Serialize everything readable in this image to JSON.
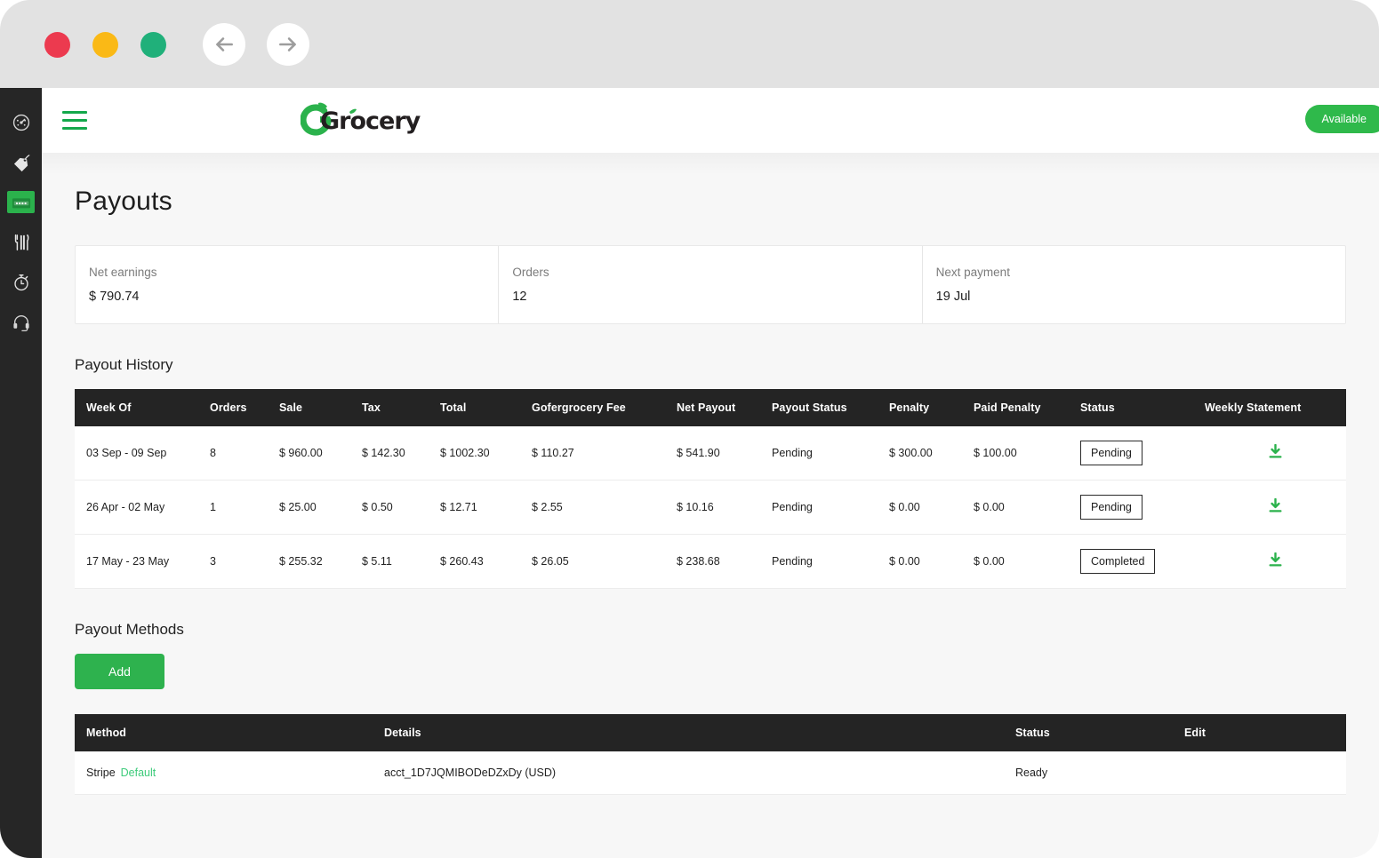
{
  "window": {
    "traffic_lights": [
      {
        "name": "close",
        "color": "#ec3a4f"
      },
      {
        "name": "minimize",
        "color": "#fab916"
      },
      {
        "name": "zoom",
        "color": "#20b07a"
      }
    ],
    "nav": {
      "back_label": "Back",
      "forward_label": "Forward"
    }
  },
  "sidebar": {
    "items": [
      {
        "name": "dashboard",
        "icon": "speedometer-icon",
        "active": false
      },
      {
        "name": "offers",
        "icon": "tag-icon",
        "active": false
      },
      {
        "name": "payouts",
        "icon": "money-card-icon",
        "active": true
      },
      {
        "name": "menu",
        "icon": "cutlery-icon",
        "active": false
      },
      {
        "name": "hours",
        "icon": "stopwatch-icon",
        "active": false
      },
      {
        "name": "support",
        "icon": "headset-icon",
        "active": false
      }
    ]
  },
  "appbar": {
    "menu_label": "Menu",
    "logo_text": "Grocery",
    "status_badge": "Available"
  },
  "page": {
    "title": "Payouts"
  },
  "summary": {
    "cards": [
      {
        "label": "Net earnings",
        "value": "$ 790.74"
      },
      {
        "label": "Orders",
        "value": "12"
      },
      {
        "label": "Next payment",
        "value": "19 Jul"
      }
    ]
  },
  "payout_history": {
    "title": "Payout History",
    "columns": [
      "Week Of",
      "Orders",
      "Sale",
      "Tax",
      "Total",
      "Gofergrocery Fee",
      "Net Payout",
      "Payout Status",
      "Penalty",
      "Paid Penalty",
      "Status",
      "Weekly Statement"
    ],
    "rows": [
      {
        "week_of": "03 Sep - 09 Sep",
        "orders": "8",
        "sale": "$ 960.00",
        "tax": "$ 142.30",
        "total": "$ 1002.30",
        "fee": "$ 110.27",
        "net_payout": "$ 541.90",
        "payout_status": "Pending",
        "penalty": "$ 300.00",
        "paid_penalty": "$ 100.00",
        "status": "Pending",
        "statement_icon": "download-icon"
      },
      {
        "week_of": "26 Apr - 02 May",
        "orders": "1",
        "sale": "$ 25.00",
        "tax": "$ 0.50",
        "total": "$ 12.71",
        "fee": "$ 2.55",
        "net_payout": "$ 10.16",
        "payout_status": "Pending",
        "penalty": "$ 0.00",
        "paid_penalty": "$ 0.00",
        "status": "Pending",
        "statement_icon": "download-icon"
      },
      {
        "week_of": "17 May - 23 May",
        "orders": "3",
        "sale": "$ 255.32",
        "tax": "$ 5.11",
        "total": "$ 260.43",
        "fee": "$ 26.05",
        "net_payout": "$ 238.68",
        "payout_status": "Pending",
        "penalty": "$ 0.00",
        "paid_penalty": "$ 0.00",
        "status": "Completed",
        "statement_icon": "download-icon"
      }
    ]
  },
  "payout_methods": {
    "title": "Payout Methods",
    "add_label": "Add",
    "columns": [
      "Method",
      "Details",
      "Status",
      "Edit"
    ],
    "rows": [
      {
        "method": "Stripe",
        "method_tag": "Default",
        "details": "acct_1D7JQMIBODeDZxDy (USD)",
        "status": "Ready",
        "edit": ""
      }
    ]
  },
  "colors": {
    "accent_green": "#2eb24e",
    "link_green": "#3ecb7b",
    "header_dark": "#242424",
    "sidebar_dark": "#262626"
  }
}
